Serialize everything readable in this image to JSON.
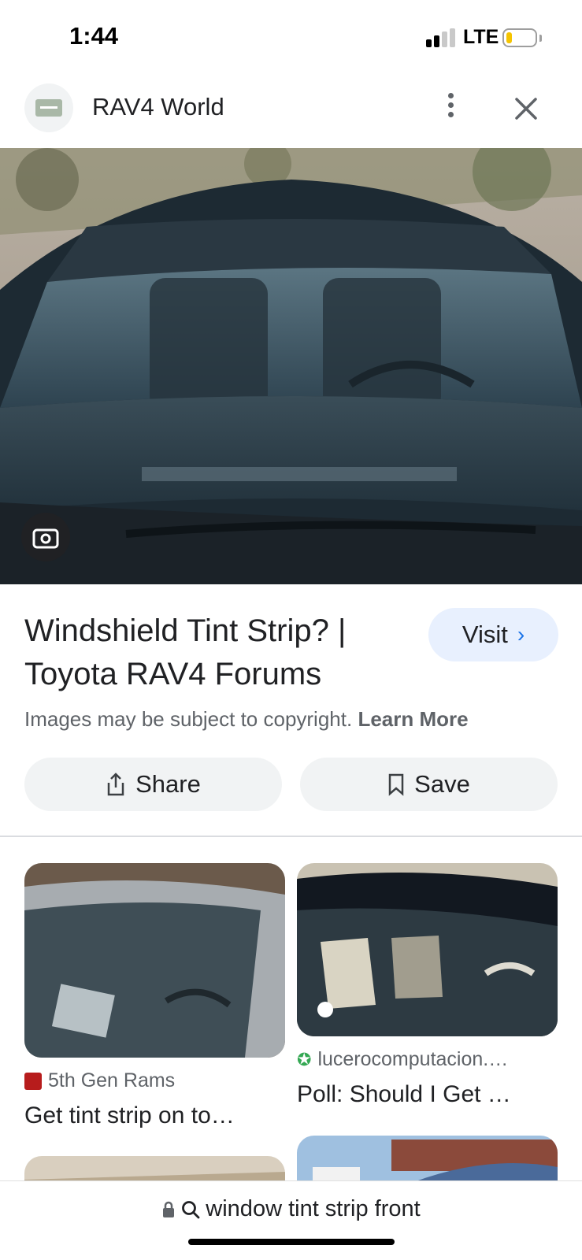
{
  "status_bar": {
    "time": "1:44",
    "network": "LTE",
    "battery_level": 0.2
  },
  "header": {
    "site_name": "RAV4 World"
  },
  "result": {
    "title_line1": "Windshield Tint Strip? |",
    "title_line2": "Toyota RAV4 Forums",
    "visit_label": "Visit",
    "copyright_text": "Images may be subject to copyright.",
    "learn_more": "Learn More",
    "share_label": "Share",
    "save_label": "Save"
  },
  "related": [
    {
      "source": "5th Gen Rams",
      "caption": "Get tint strip on to…"
    },
    {
      "source": "lucerocomputacion.…",
      "caption": "Poll: Should I Get …"
    }
  ],
  "search": {
    "query": "window tint strip front"
  },
  "colors": {
    "accent": "#1a73e8",
    "pill_bg": "#f1f3f4",
    "visit_bg": "#e8f0fe"
  }
}
